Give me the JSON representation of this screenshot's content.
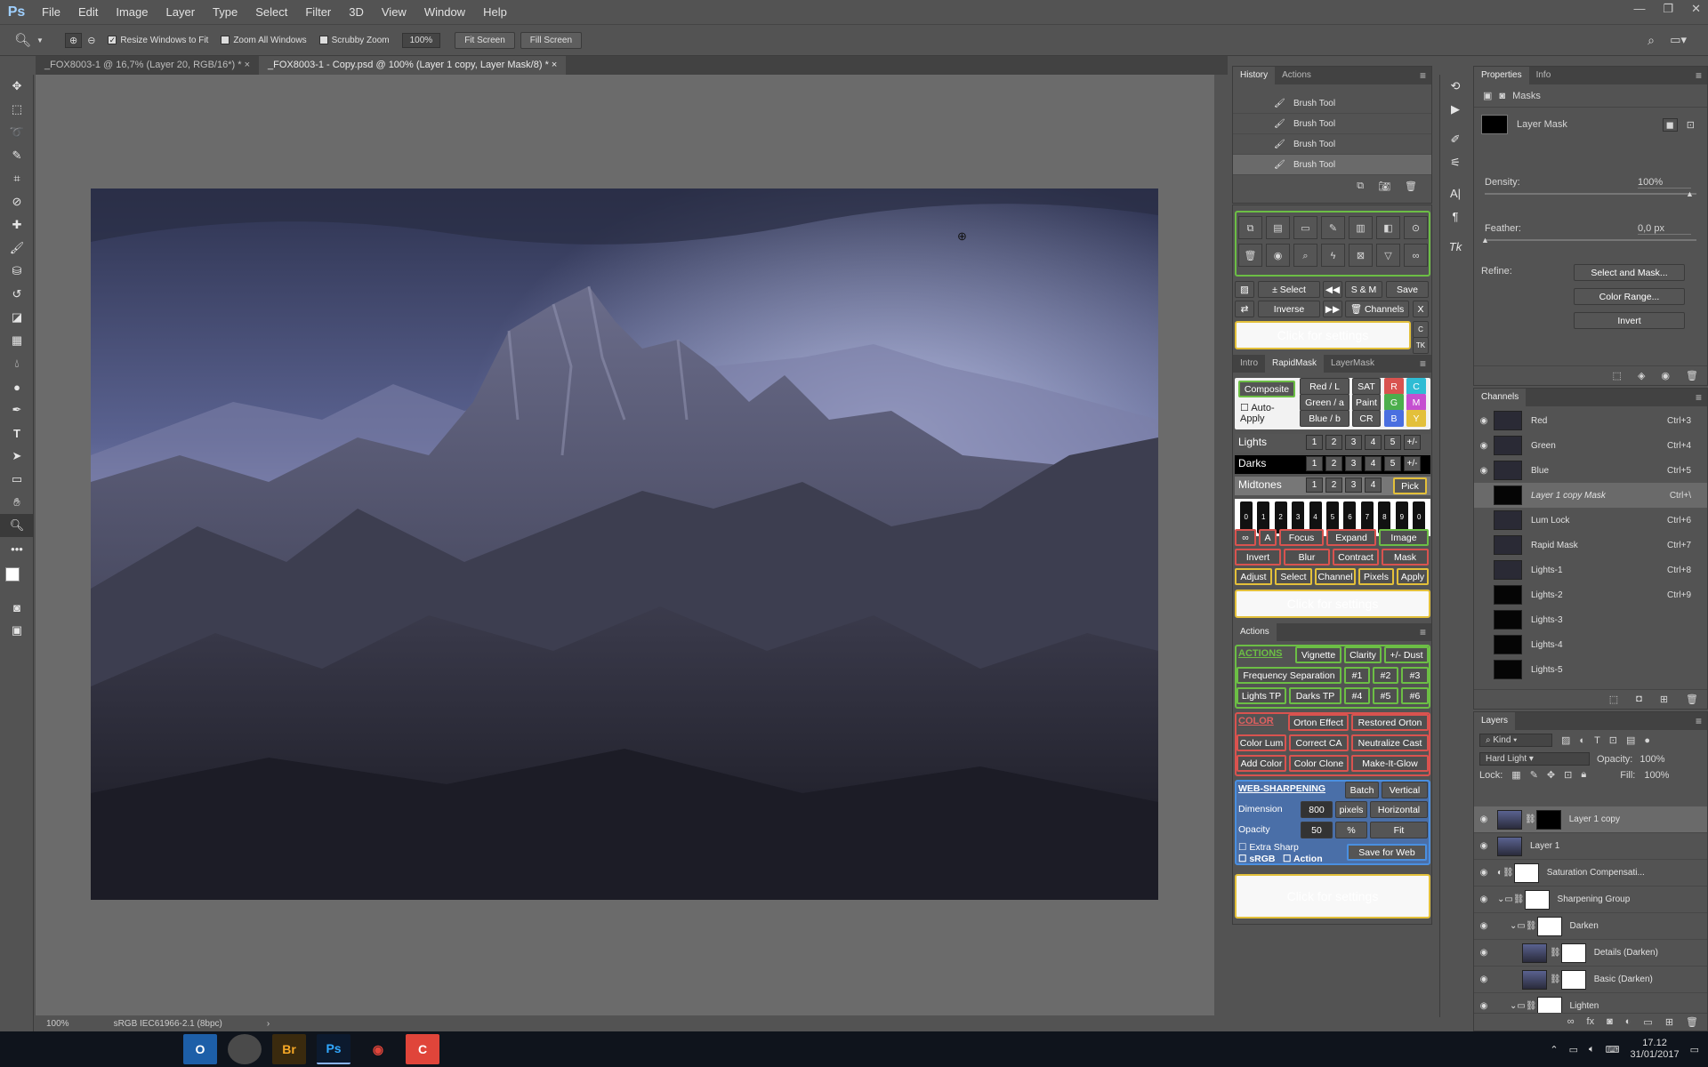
{
  "app": {
    "logo": "Ps"
  },
  "menu": [
    "File",
    "Edit",
    "Image",
    "Layer",
    "Type",
    "Select",
    "Filter",
    "3D",
    "View",
    "Window",
    "Help"
  ],
  "options": {
    "resize_windows": "Resize Windows to Fit",
    "zoom_all": "Zoom All Windows",
    "scrubby": "Scrubby Zoom",
    "zoom_value": "100%",
    "fit_screen": "Fit Screen",
    "fill_screen": "Fill Screen"
  },
  "tabs": [
    "_FOX8003-1 @ 16,7% (Layer 20, RGB/16*) *",
    "_FOX8003-1 - Copy.psd @ 100% (Layer 1 copy, Layer Mask/8) *"
  ],
  "status": {
    "zoom": "100%",
    "profile": "sRGB IEC61966-2.1 (8bpc)"
  },
  "history": {
    "tabs": [
      "History",
      "Actions"
    ],
    "items": [
      "Brush Tool",
      "Brush Tool",
      "Brush Tool",
      "Brush Tool"
    ]
  },
  "ext": {
    "quick": [
      "± Select",
      "S & M",
      "Save",
      "Inverse",
      "Channels",
      "X"
    ],
    "settings": "Click for settings",
    "tabs": [
      "Intro",
      "RapidMask",
      "LayerMask"
    ],
    "composite": "Composite",
    "auto_apply": "Auto-Apply",
    "rgb": [
      "Red / L",
      "Green / a",
      "Blue / b"
    ],
    "sat": [
      "SAT",
      "Paint",
      "CR"
    ],
    "cmyk": [
      "C",
      "M",
      "Y",
      "R",
      "G",
      "B"
    ],
    "lights": "Lights",
    "darks": "Darks",
    "midtones": "Midtones",
    "pick": "Pick",
    "nums5": [
      "1",
      "2",
      "3",
      "4",
      "5",
      "+/-"
    ],
    "nums4": [
      "1",
      "2",
      "3",
      "4"
    ],
    "zone_nums": [
      "0",
      "1",
      "2",
      "3",
      "4",
      "5",
      "6",
      "7",
      "8",
      "9",
      "0"
    ],
    "row1": [
      "∞",
      "A",
      "Focus",
      "Expand",
      "Image"
    ],
    "row2": [
      "Invert",
      "Blur",
      "Contract",
      "Mask"
    ],
    "row3": [
      "Adjust",
      "Select",
      "Channel",
      "Pixels",
      "Apply"
    ],
    "actions_title": "Actions",
    "actions": {
      "head": "ACTIONS",
      "vignette": "Vignette",
      "clarity": "Clarity",
      "dust": "+/- Dust",
      "freq": "Frequency Separation",
      "n1": "#1",
      "n2": "#2",
      "n3": "#3",
      "ltp": "Lights TP",
      "dtp": "Darks TP",
      "n4": "#4",
      "n5": "#5",
      "n6": "#6"
    },
    "color": {
      "head": "COLOR",
      "orton": "Orton Effect",
      "rorton": "Restored Orton",
      "lum": "Color Lum",
      "ca": "Correct CA",
      "cast": "Neutralize Cast",
      "add": "Add Color",
      "clone": "Color Clone",
      "glow": "Make-It-Glow"
    },
    "web": {
      "head": "WEB-SHARPENING",
      "batch": "Batch",
      "vertical": "Vertical",
      "dim": "Dimension",
      "dim_val": "800",
      "pixels": "pixels",
      "horizontal": "Horizontal",
      "opacity": "Opacity",
      "op_val": "50",
      "pct": "%",
      "fit": "Fit",
      "extra": "Extra Sharp",
      "srgb": "sRGB",
      "action": "Action",
      "save": "Save for Web"
    }
  },
  "properties": {
    "tabs": [
      "Properties",
      "Info"
    ],
    "masks": "Masks",
    "layer_mask": "Layer Mask",
    "density": "Density:",
    "density_val": "100%",
    "feather": "Feather:",
    "feather_val": "0,0 px",
    "refine": "Refine:",
    "select_mask": "Select and Mask...",
    "color_range": "Color Range...",
    "invert": "Invert"
  },
  "channels": {
    "title": "Channels",
    "rows": [
      {
        "name": "Red",
        "key": "Ctrl+3",
        "eye": true,
        "black": false,
        "italic": false
      },
      {
        "name": "Green",
        "key": "Ctrl+4",
        "eye": true,
        "black": false,
        "italic": false
      },
      {
        "name": "Blue",
        "key": "Ctrl+5",
        "eye": true,
        "black": false,
        "italic": false
      },
      {
        "name": "Layer 1 copy Mask",
        "key": "Ctrl+\\",
        "eye": false,
        "black": true,
        "italic": true
      },
      {
        "name": "Lum Lock",
        "key": "Ctrl+6",
        "eye": false,
        "black": false,
        "italic": false
      },
      {
        "name": "Rapid Mask",
        "key": "Ctrl+7",
        "eye": false,
        "black": false,
        "italic": false
      },
      {
        "name": "Lights-1",
        "key": "Ctrl+8",
        "eye": false,
        "black": false,
        "italic": false
      },
      {
        "name": "Lights-2",
        "key": "Ctrl+9",
        "eye": false,
        "black": true,
        "italic": false
      },
      {
        "name": "Lights-3",
        "key": "",
        "eye": false,
        "black": true,
        "italic": false
      },
      {
        "name": "Lights-4",
        "key": "",
        "eye": false,
        "black": true,
        "italic": false
      },
      {
        "name": "Lights-5",
        "key": "",
        "eye": false,
        "black": true,
        "italic": false
      }
    ]
  },
  "layers": {
    "title": "Layers",
    "kind": "Kind",
    "blend": "Hard Light",
    "opacity_label": "Opacity:",
    "opacity": "100%",
    "lock": "Lock:",
    "fill_label": "Fill:",
    "fill": "100%",
    "rows": [
      {
        "name": "Layer 1 copy",
        "indent": 0,
        "type": "photo-mask",
        "sel": true
      },
      {
        "name": "Layer 1",
        "indent": 0,
        "type": "photo",
        "sel": false
      },
      {
        "name": "Saturation Compensati...",
        "indent": 0,
        "type": "adj",
        "sel": false
      },
      {
        "name": "Sharpening Group",
        "indent": 0,
        "type": "group",
        "sel": false
      },
      {
        "name": "Darken",
        "indent": 1,
        "type": "group",
        "sel": false
      },
      {
        "name": "Details (Darken)",
        "indent": 2,
        "type": "photo-white",
        "sel": false
      },
      {
        "name": "Basic (Darken)",
        "indent": 2,
        "type": "photo-white",
        "sel": false
      },
      {
        "name": "Lighten",
        "indent": 1,
        "type": "group",
        "sel": false
      }
    ]
  },
  "taskbar": {
    "time": "17.12",
    "date": "31/01/2017",
    "apps": [
      "O",
      "Br",
      "Ps",
      "◉",
      "C"
    ]
  }
}
